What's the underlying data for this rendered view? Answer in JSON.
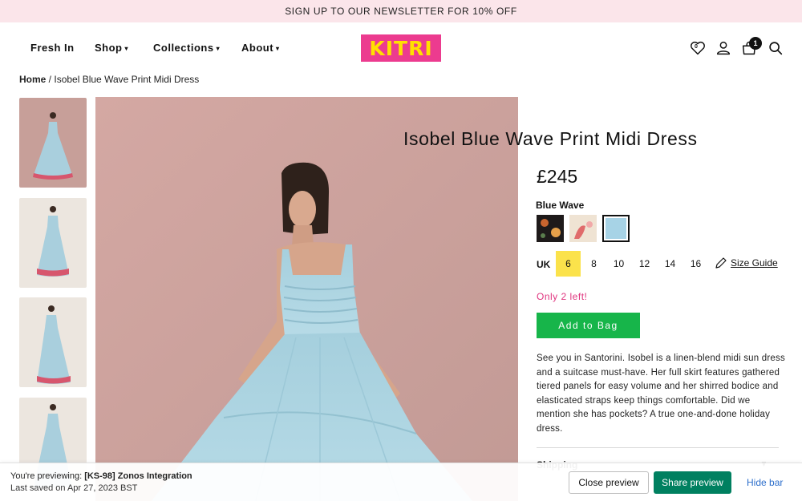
{
  "promo": {
    "text": "SIGN UP TO OUR NEWSLETTER FOR 10% OFF"
  },
  "nav": {
    "items": [
      {
        "label": "Fresh In"
      },
      {
        "label": "Shop"
      },
      {
        "label": "Collections"
      },
      {
        "label": "About"
      }
    ],
    "caret": "▾",
    "logo": "KITRI",
    "wishlist_count": "0",
    "bag_count": "1",
    "icons": [
      "heart-icon",
      "user-icon",
      "bag-icon",
      "search-icon"
    ]
  },
  "breadcrumb": {
    "home": "Home",
    "separator": " / ",
    "current": "Isobel Blue Wave Print Midi Dress"
  },
  "product": {
    "title": "Isobel Blue Wave Print Midi Dress",
    "price": "£245",
    "colour_name": "Blue Wave",
    "size_prefix": "UK",
    "sizes": [
      "6",
      "8",
      "10",
      "12",
      "14",
      "16"
    ],
    "selected_size": "6",
    "size_guide": "Size Guide",
    "stock": "Only 2 left!",
    "add_to_bag": "Add to Bag",
    "description": "See you in Santorini. Isobel is a linen-blend midi sun dress and a suitcase must-have. Her full skirt features gathered tiered panels for easy volume and her shirred bodice and elasticated straps keep things comfortable. Did we mention she has pockets? A true one-and-done holiday dress.",
    "accordion": "Shipping"
  },
  "preview_bar": {
    "prefix": "You're previewing: ",
    "theme": "[KS-98] Zonos Integration",
    "saved": "Last saved on Apr 27, 2023 BST",
    "close": "Close preview",
    "share": "Share preview",
    "hide": "Hide bar"
  },
  "colors": {
    "promo_bg": "#fbe5ea",
    "logo_bg": "#ec3b8f",
    "logo_text": "#ffe000",
    "add_to_bag": "#17b54a",
    "stock": "#e0357f",
    "selected_size": "#fbe24b",
    "share_button": "#008060",
    "hide_link": "#2c6ecb"
  }
}
